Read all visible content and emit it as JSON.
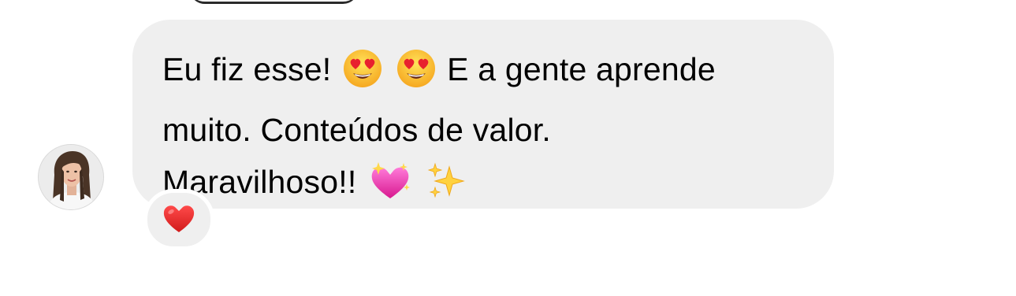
{
  "message": {
    "line1_a": "Eu fiz esse!",
    "line1_b": "E a gente aprende",
    "line2": "muito. Conteúdos de valor.",
    "line3": "Maravilhoso!!",
    "line1_emojis": [
      "heart-eyes-emoji",
      "heart-eyes-emoji"
    ],
    "line3_emojis": [
      "sparkling-heart-emoji",
      "sparkles-emoji"
    ]
  },
  "reaction": {
    "icon": "red-heart-emoji"
  },
  "colors": {
    "bubble": "#efefef",
    "text": "#000000",
    "heart": "#e02b2b"
  }
}
